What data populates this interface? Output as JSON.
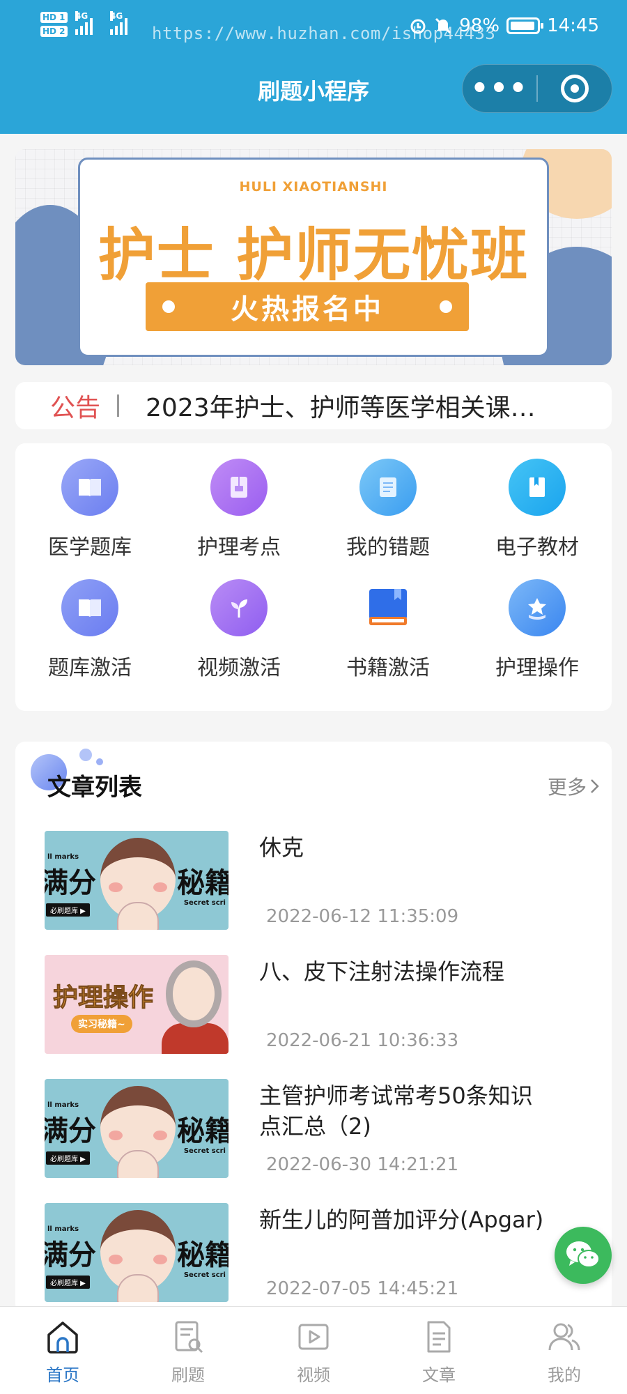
{
  "status_bar": {
    "sim1": "HD 1",
    "sim2": "HD 2",
    "net1": "4G",
    "net2": "4G",
    "watermark": "https://www.huzhan.com/ishop44433",
    "battery": "98%",
    "time": "14:45"
  },
  "nav": {
    "title": "刷题小程序",
    "more_icon": "more-dots-icon",
    "close_icon": "target-icon"
  },
  "banner": {
    "subtitle_en": "HULI XIAOTIANSHI",
    "headline": "护士 护师无忧班",
    "button": "火热报名中",
    "colors": {
      "accent": "#f0a037",
      "frame": "#6f8fbf"
    }
  },
  "notice": {
    "tag": "公告",
    "text": "2023年护士、护师等医学相关课…"
  },
  "grid": {
    "items": [
      {
        "label": "医学题库",
        "icon": "book-icon"
      },
      {
        "label": "护理考点",
        "icon": "folder-icon"
      },
      {
        "label": "我的错题",
        "icon": "scroll-icon"
      },
      {
        "label": "电子教材",
        "icon": "bookmark-book-icon"
      },
      {
        "label": "题库激活",
        "icon": "book-icon"
      },
      {
        "label": "视频激活",
        "icon": "leaf-icon"
      },
      {
        "label": "书籍激活",
        "icon": "books-icon"
      },
      {
        "label": "护理操作",
        "icon": "star-badge-icon"
      }
    ]
  },
  "articles": {
    "title": "文章列表",
    "more": "更多",
    "items": [
      {
        "title": "休克",
        "date": "2022-06-12 11:35:09",
        "thumb": "secret"
      },
      {
        "title": "八、皮下注射法操作流程",
        "date": "2022-06-21 10:36:33",
        "thumb": "ops"
      },
      {
        "title": "主管护师考试常考50条知识点汇总（2)",
        "date": "2022-06-30 14:21:21",
        "thumb": "secret"
      },
      {
        "title": "新生儿的阿普加评分(Apgar)",
        "date": "2022-07-05 14:45:21",
        "thumb": "secret"
      }
    ],
    "thumb_text": {
      "left": "满分",
      "right": "秘籍",
      "small_left": "ll marks",
      "small_right": "Secret scri",
      "chip": "必刷题库 ▶",
      "ops": "护理操作",
      "ops_sub": "实习秘籍~"
    }
  },
  "fab": {
    "icon": "wechat-icon"
  },
  "tabbar": {
    "items": [
      {
        "label": "首页",
        "icon": "home-icon",
        "active": true
      },
      {
        "label": "刷题",
        "icon": "quiz-icon",
        "active": false
      },
      {
        "label": "视频",
        "icon": "video-icon",
        "active": false
      },
      {
        "label": "文章",
        "icon": "article-icon",
        "active": false
      },
      {
        "label": "我的",
        "icon": "user-icon",
        "active": false
      }
    ],
    "active_color": "#2a76c6"
  }
}
